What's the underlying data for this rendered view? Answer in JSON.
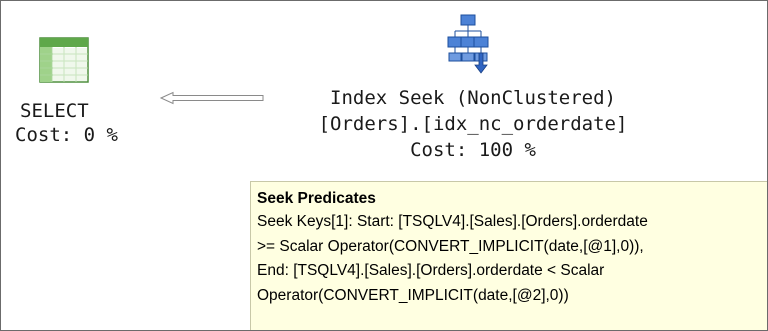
{
  "select_node": {
    "icon": "results-grid-icon",
    "label": "SELECT",
    "cost": "Cost: 0 %"
  },
  "seek_node": {
    "icon": "index-seek-icon",
    "title": "Index Seek (NonClustered)",
    "object": "[Orders].[idx_nc_orderdate]",
    "cost": "Cost: 100 %"
  },
  "tooltip": {
    "title": "Seek Predicates",
    "lines": [
      "Seek Keys[1]: Start: [TSQLV4].[Sales].[Orders].orderdate",
      ">= Scalar Operator(CONVERT_IMPLICIT(date,[@1],0)),",
      "End: [TSQLV4].[Sales].[Orders].orderdate < Scalar",
      "Operator(CONVERT_IMPLICIT(date,[@2],0))"
    ]
  },
  "colors": {
    "tooltip_background": "#ffffe1",
    "grid_green": "#7fbf6a",
    "seek_blue": "#3a6fc4"
  }
}
